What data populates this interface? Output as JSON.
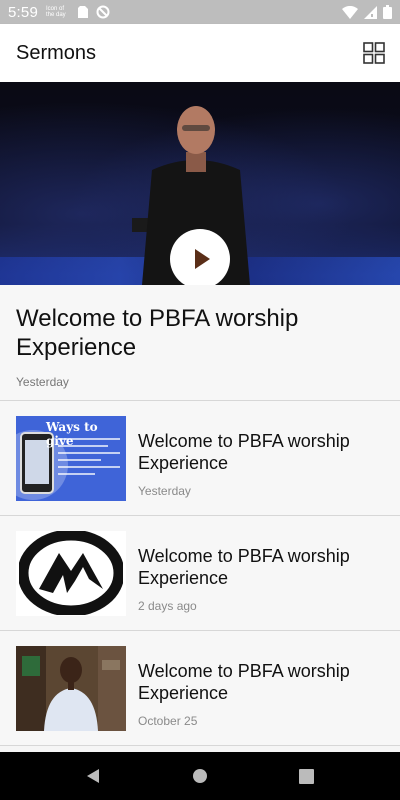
{
  "status_bar": {
    "time": "5:59",
    "notification_text": "Icon of the day",
    "icons": [
      "sim-card-icon",
      "do-not-disturb-icon",
      "wifi-icon",
      "cellular-signal-icon",
      "battery-icon"
    ]
  },
  "app_bar": {
    "title": "Sermons",
    "grid_icon": "grid-view-icon"
  },
  "hero": {
    "play_icon": "play-icon"
  },
  "featured": {
    "title": "Welcome to PBFA worship Experience",
    "date": "Yesterday"
  },
  "list": {
    "items": [
      {
        "title": "Welcome to PBFA worship Experience",
        "date": "Yesterday",
        "thumbnail_text": "Ways to give"
      },
      {
        "title": "Welcome to PBFA worship Experience",
        "date": "2 days ago"
      },
      {
        "title": "Welcome to PBFA worship Experience",
        "date": "October 25"
      }
    ]
  },
  "nav_bar": {
    "icons": [
      "back-icon",
      "home-icon",
      "recents-icon"
    ]
  },
  "colors": {
    "status_bar": "#bdbdbd",
    "play_triangle": "#5a2e18",
    "give_thumb": "#3f64d8",
    "nav_bar": "#000000"
  }
}
